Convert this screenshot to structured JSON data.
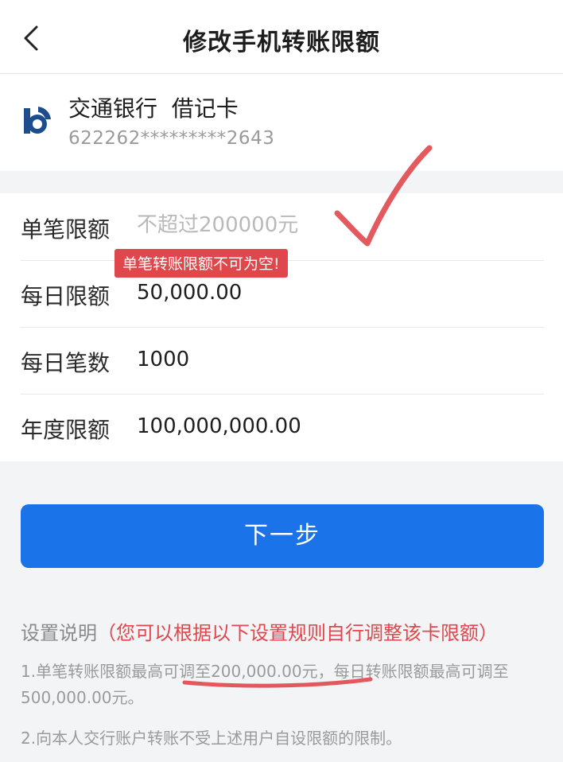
{
  "navbar": {
    "title": "修改手机转账限额",
    "back_icon": "chevron-left-icon"
  },
  "card": {
    "bank_name": "交通银行  借记卡",
    "card_number": "622262*********2643",
    "logo_icon": "bocom-logo-icon",
    "logo_color": "#1b4d8f"
  },
  "form": {
    "single_limit": {
      "label": "单笔限额",
      "value": "",
      "placeholder": "不超过200000元",
      "error": "单笔转账限额不可为空!"
    },
    "daily_limit": {
      "label": "每日限额",
      "value": "50,000.00"
    },
    "daily_count": {
      "label": "每日笔数",
      "value": "1000"
    },
    "annual_limit": {
      "label": "年度限额",
      "value": "100,000,000.00"
    }
  },
  "next_button": {
    "label": "下一步",
    "color": "#1a73e8"
  },
  "notes": {
    "title": "设置说明",
    "hint": "（您可以根据以下设置规则自行调整该卡限额）",
    "line1": "1.单笔转账限额最高可调至200,000.00元，每日转账限额最高可调至500,000.00元。",
    "line2": "2.向本人交行账户转账不受上述用户自设限额的限制。"
  },
  "colors": {
    "error": "#e0474c",
    "annotation": "#e0474c",
    "background": "#f3f4f6"
  }
}
